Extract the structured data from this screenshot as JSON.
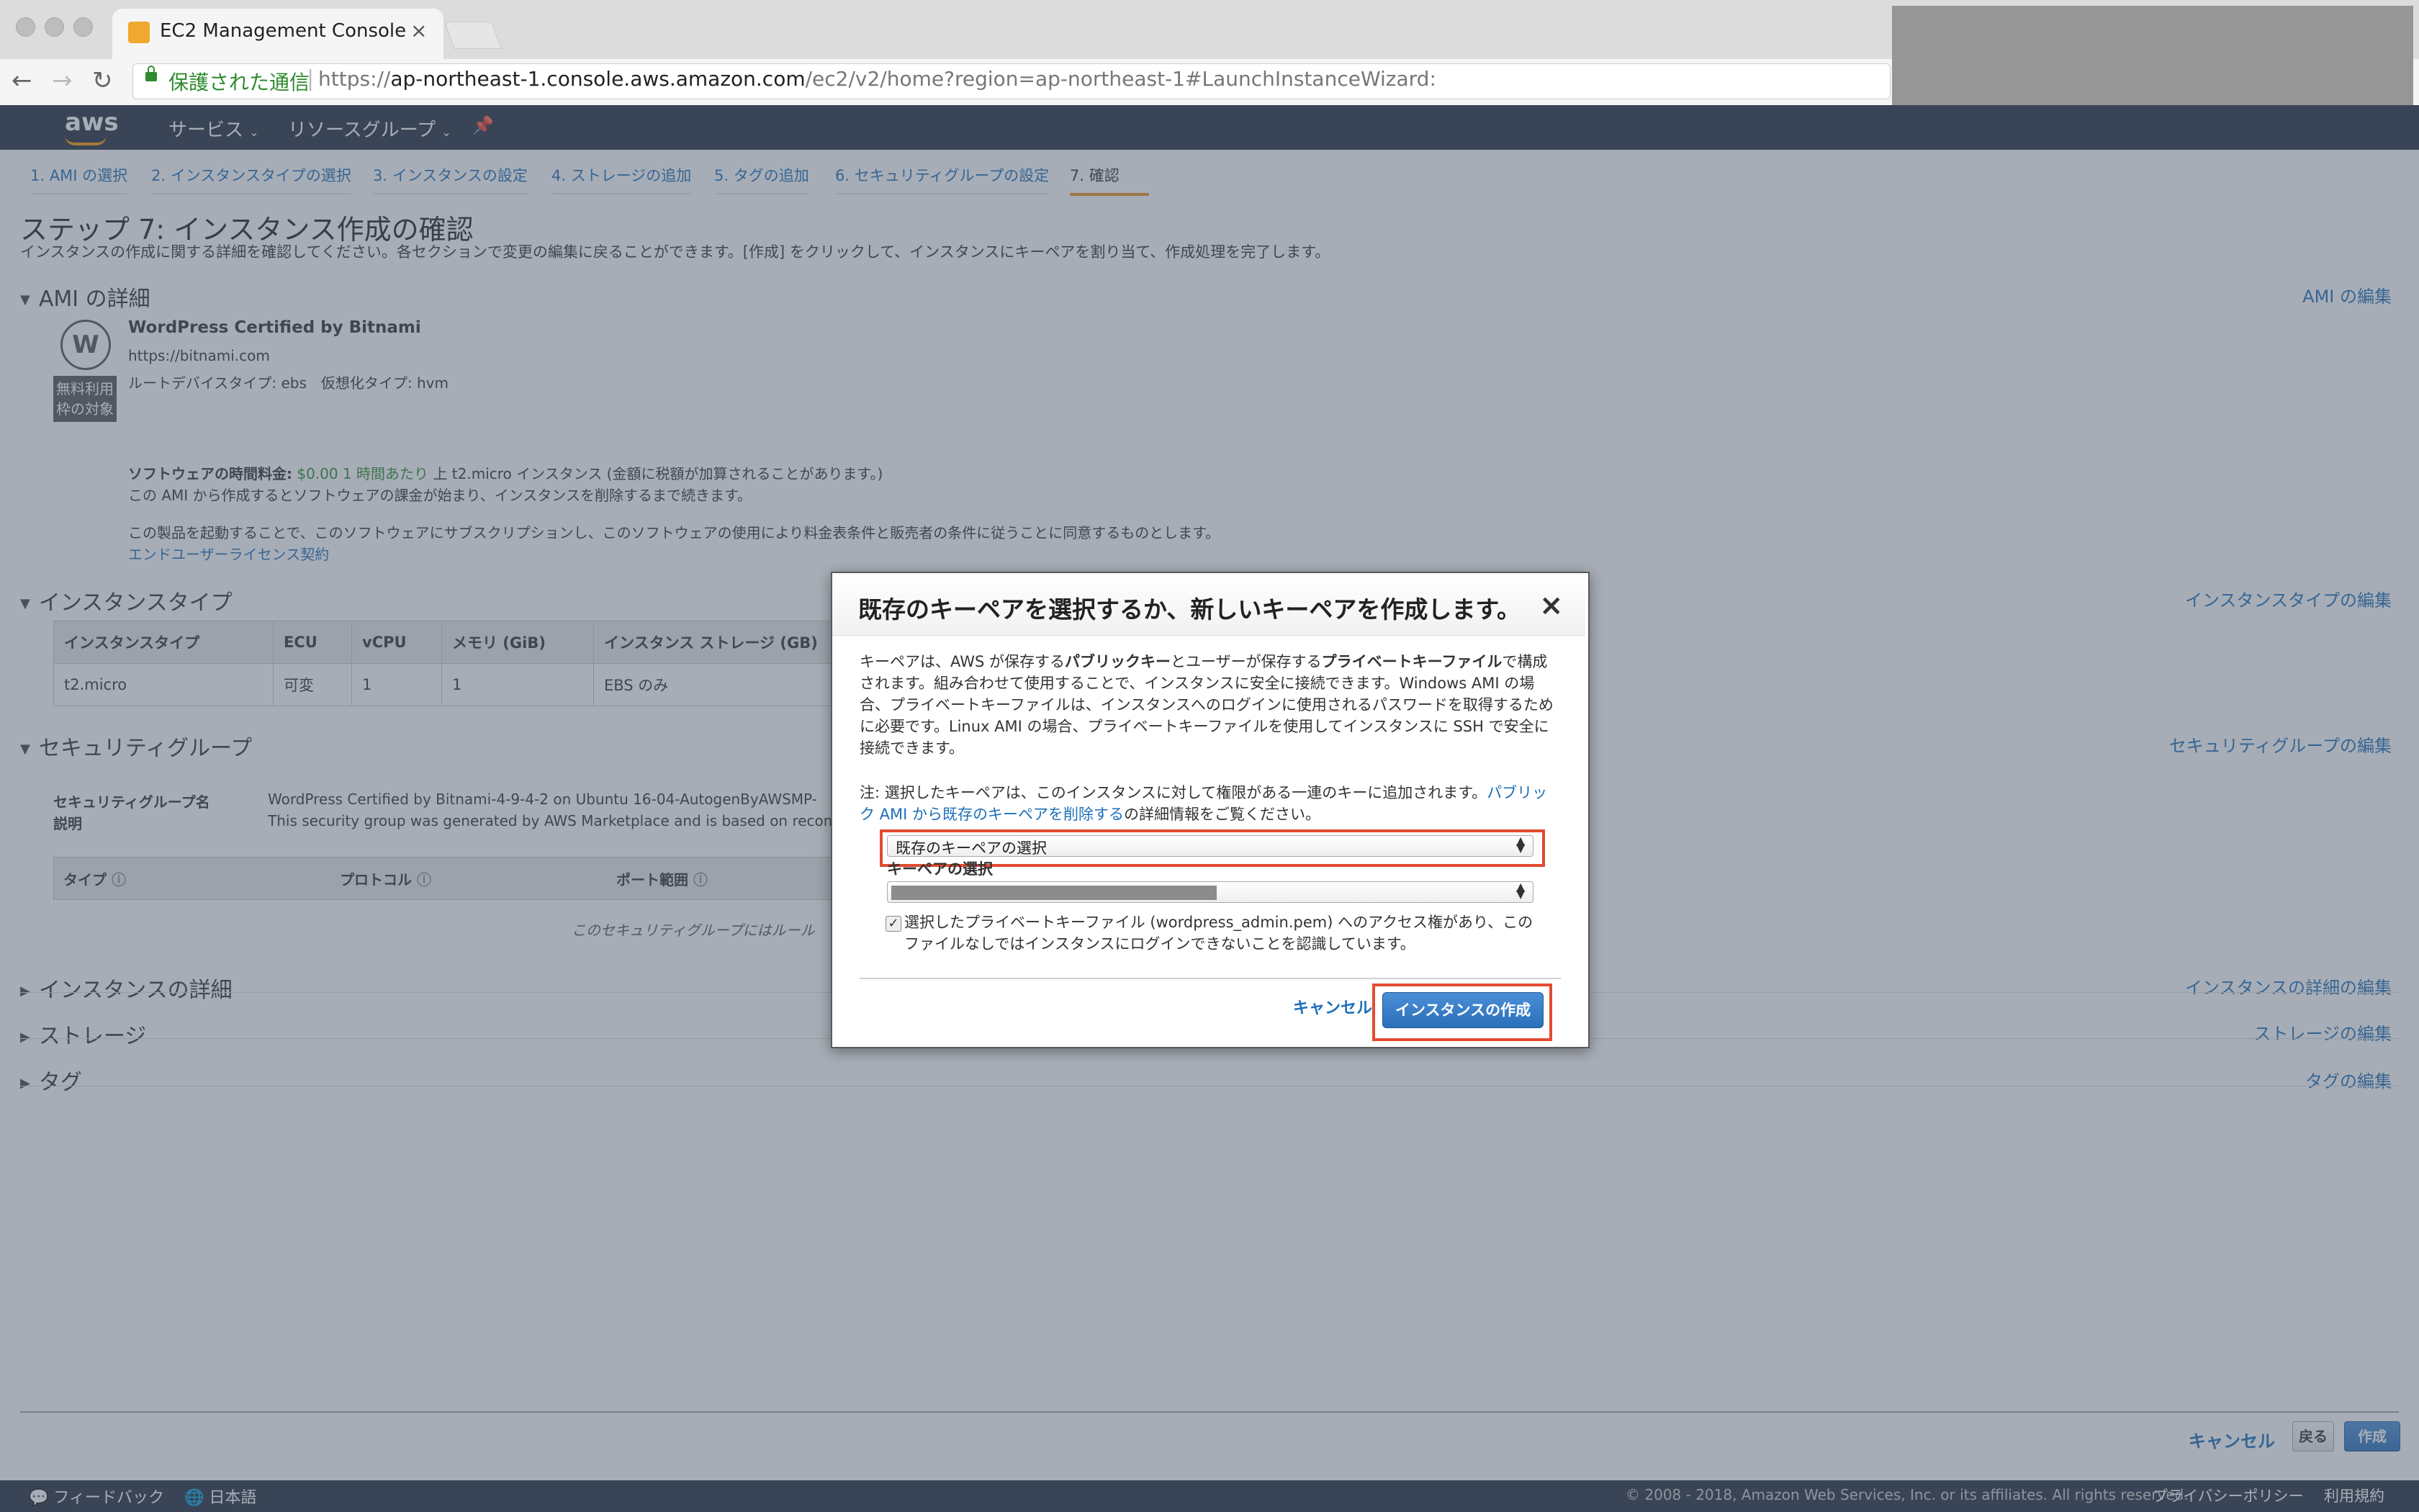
{
  "browser": {
    "tab_title": "EC2 Management Console",
    "secure_label": "保護された通信",
    "url_scheme": "https://",
    "url_host": "ap-northeast-1.console.aws.amazon.com",
    "url_path": "/ec2/v2/home?region=ap-northeast-1#LaunchInstanceWizard:"
  },
  "awsnav": {
    "logo": "aws",
    "services": "サービス",
    "resource_groups": "リソースグループ"
  },
  "wizard_steps": [
    "1. AMI の選択",
    "2. インスタンスタイプの選択",
    "3. インスタンスの設定",
    "4. ストレージの追加",
    "5. タグの追加",
    "6. セキュリティグループの設定",
    "7. 確認"
  ],
  "page": {
    "title": "ステップ 7: インスタンス作成の確認",
    "description": "インスタンスの作成に関する詳細を確認してください。各セクションで変更の編集に戻ることができます。[作成] をクリックして、インスタンスにキーペアを割り当て、作成処理を完了します。"
  },
  "ami": {
    "section": "AMI の詳細",
    "edit": "AMI の編集",
    "name": "WordPress Certified by Bitnami",
    "url": "https://bitnami.com",
    "meta": "ルートデバイスタイプ: ebs　仮想化タイプ: hvm",
    "free_tier": "無料利用枠の対象",
    "pricing_label": "ソフトウェアの時間料金:",
    "pricing_value": "$0.00 1 時間あたり",
    "pricing_rest": "上 t2.micro インスタンス (金額に税額が加算されることがあります。)",
    "billing_note": "この AMI から作成するとソフトウェアの課金が始まり、インスタンスを削除するまで続きます。",
    "agree_note": "この製品を起動することで、このソフトウェアにサブスクリプションし、このソフトウェアの使用により料金表条件と販売者の条件に従うことに同意するものとします。",
    "eula_link": "エンドユーザーライセンス契約"
  },
  "instance_type": {
    "section": "インスタンスタイプ",
    "edit": "インスタンスタイプの編集",
    "headers": [
      "インスタンスタイプ",
      "ECU",
      "vCPU",
      "メモリ (GiB)",
      "インスタンス ストレージ (GB)"
    ],
    "row": [
      "t2.micro",
      "可変",
      "1",
      "1",
      "EBS のみ"
    ]
  },
  "security_group": {
    "section": "セキュリティグループ",
    "edit": "セキュリティグループの編集",
    "name_label": "セキュリティグループ名",
    "desc_label": "説明",
    "name_value": "WordPress Certified by Bitnami-4-9-4-2 on Ubuntu 16-04-AutogenByAWSMP-",
    "desc_value": "This security group was generated by AWS Marketplace and is based on recommen",
    "headers": [
      "タイプ",
      "プロトコル",
      "ポート範囲"
    ],
    "empty": "このセキュリティグループにはルール"
  },
  "collapsed_sections": [
    {
      "label": "インスタンスの詳細",
      "edit": "インスタンスの詳細の編集"
    },
    {
      "label": "ストレージ",
      "edit": "ストレージの編集"
    },
    {
      "label": "タグ",
      "edit": "タグの編集"
    }
  ],
  "bottom_buttons": {
    "cancel": "キャンセル",
    "back": "戻る",
    "create": "作成"
  },
  "footer": {
    "feedback": "フィードバック",
    "language": "日本語",
    "copyright": "© 2008 - 2018, Amazon Web Services, Inc. or its affiliates. All rights reserved.",
    "privacy": "プライバシーポリシー",
    "terms": "利用規約"
  },
  "modal": {
    "title": "既存のキーペアを選択するか、新しいキーペアを作成します。",
    "p1_a": "キーペアは、AWS が保存する",
    "p1_b": "パブリックキー",
    "p1_c": "とユーザーが保存する",
    "p1_d": "プライベートキーファイル",
    "p1_e": "で構成されます。組み合わせて使用することで、インスタンスに安全に接続できます。Windows AMI の場合、プライベートキーファイルは、インスタンスへのログインに使用されるパスワードを取得するために必要です。Linux AMI の場合、プライベートキーファイルを使用してインスタンスに SSH で安全に接続できます。",
    "p2_a": "注: 選択したキーペアは、このインスタンスに対して権限がある一連のキーに追加されます。",
    "p2_link": "パブリック AMI から既存のキーペアを削除する",
    "p2_b": "の詳細情報をご覧ください。",
    "select_option": "既存のキーペアの選択",
    "keypair_label": "キーペアの選択",
    "ack_text": "選択したプライベートキーファイル (wordpress_admin.pem) へのアクセス権があり、このファイルなしではインスタンスにログインできないことを認識しています。",
    "cancel": "キャンセル",
    "launch": "インスタンスの作成"
  }
}
